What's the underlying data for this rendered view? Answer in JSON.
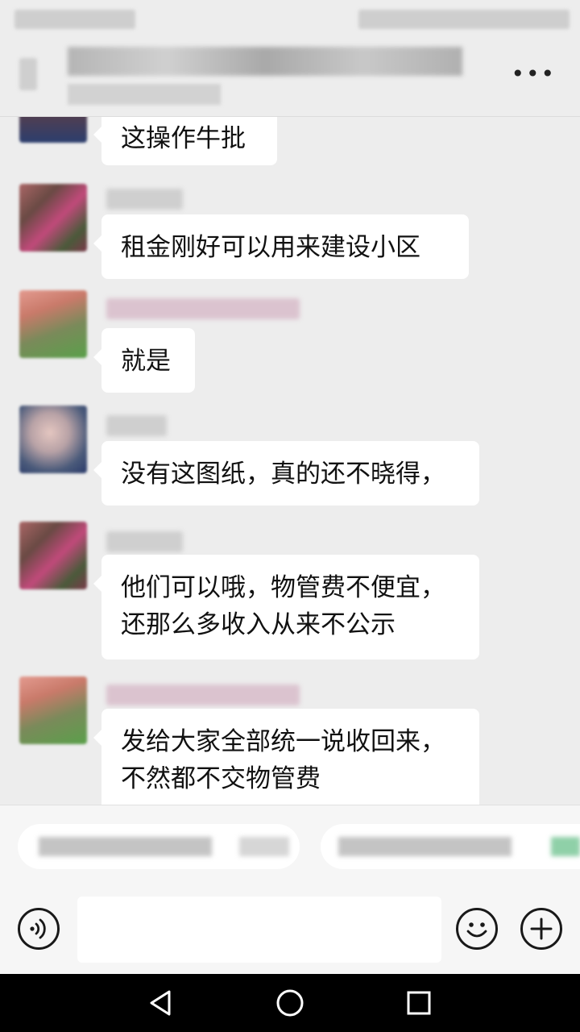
{
  "header": {
    "title": "",
    "subtitle": "",
    "more_label": "•••"
  },
  "messages": [
    {
      "text": "这操作牛批",
      "avatar_color": "#5a3e4a"
    },
    {
      "text": "租金刚好可以用来建设小区",
      "avatar_color": "#7a4a4c"
    },
    {
      "text": "就是",
      "avatar_color": "#9a6a55"
    },
    {
      "text": "没有这图纸，真的还不晓得，",
      "avatar_color": "#6a6a80"
    },
    {
      "text": "他们可以哦，物管费不便宜，\n还那么多收入从来不公示",
      "avatar_color": "#7a4a4c"
    },
    {
      "text": "发给大家全部统一说收回来，\n不然都不交物管费",
      "avatar_color": "#9a6a55"
    }
  ],
  "composer": {
    "input_value": "",
    "voice_icon": "voice-icon",
    "emoji_icon": "emoji-icon",
    "plus_icon": "plus-icon"
  },
  "colors": {
    "background": "#ededed",
    "bubble": "#ffffff",
    "text": "#111111",
    "navbar": "#000000"
  }
}
